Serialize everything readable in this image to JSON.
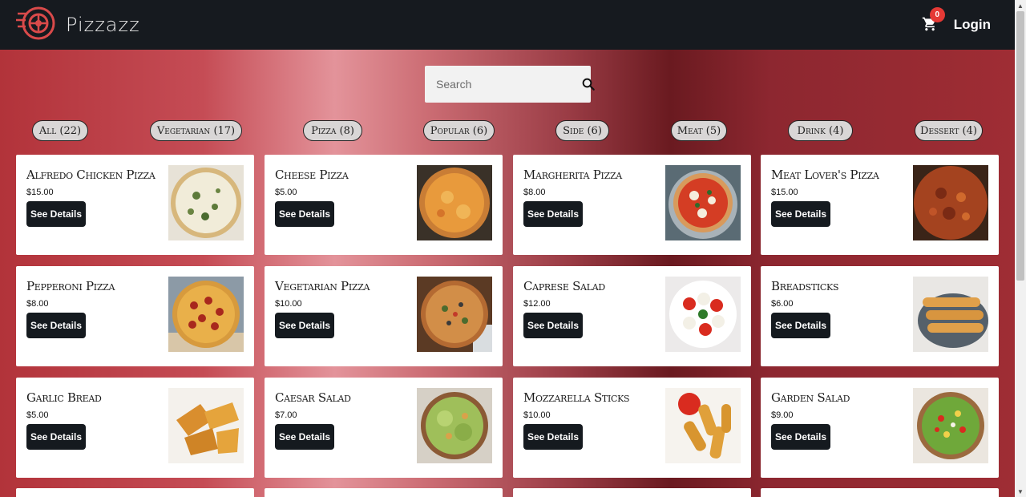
{
  "header": {
    "brand": "Pizzazz",
    "logo_icon": "pizza-wheel-logo",
    "cart_count": "0",
    "login_label": "Login"
  },
  "search": {
    "placeholder": "Search"
  },
  "filters": [
    {
      "label": "All (22)"
    },
    {
      "label": "Vegetarian (17)"
    },
    {
      "label": "Pizza (8)"
    },
    {
      "label": "Popular (6)"
    },
    {
      "label": "Side (6)"
    },
    {
      "label": "Meat (5)"
    },
    {
      "label": "Drink (4)"
    },
    {
      "label": "Dessert (4)"
    }
  ],
  "products": [
    {
      "name": "Alfredo Chicken Pizza",
      "price": "$15.00",
      "image": "alfredo-pizza"
    },
    {
      "name": "Cheese Pizza",
      "price": "$5.00",
      "image": "cheese-pizza"
    },
    {
      "name": "Margherita Pizza",
      "price": "$8.00",
      "image": "margherita-pizza"
    },
    {
      "name": "Meat Lover's Pizza",
      "price": "$15.00",
      "image": "meat-pizza"
    },
    {
      "name": "Pepperoni Pizza",
      "price": "$8.00",
      "image": "pepperoni-pizza"
    },
    {
      "name": "Vegetarian Pizza",
      "price": "$10.00",
      "image": "vegetarian-pizza"
    },
    {
      "name": "Caprese Salad",
      "price": "$12.00",
      "image": "caprese-salad"
    },
    {
      "name": "Breadsticks",
      "price": "$6.00",
      "image": "breadsticks"
    },
    {
      "name": "Garlic Bread",
      "price": "$5.00",
      "image": "garlic-bread"
    },
    {
      "name": "Caesar Salad",
      "price": "$7.00",
      "image": "caesar-salad"
    },
    {
      "name": "Mozzarella Sticks",
      "price": "$10.00",
      "image": "mozzarella-sticks"
    },
    {
      "name": "Garden Salad",
      "price": "$9.00",
      "image": "garden-salad"
    }
  ],
  "card_button_label": "See Details",
  "colors": {
    "navbar": "#161a1f",
    "button": "#151a1f",
    "badge": "#e53935",
    "accent": "#b5343a"
  }
}
